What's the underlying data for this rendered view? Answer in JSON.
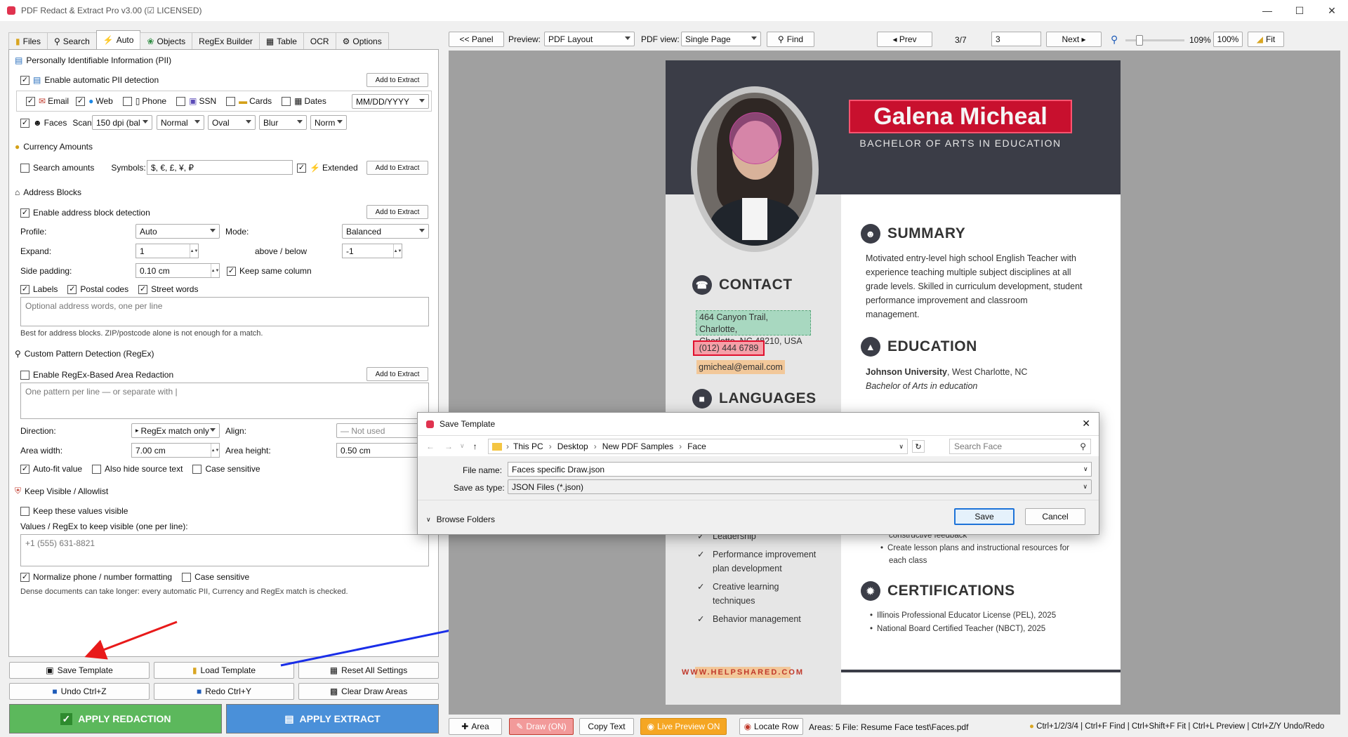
{
  "window": {
    "title": "PDF Redact & Extract Pro v3.00 (☑ LICENSED)"
  },
  "tabs": [
    {
      "label": "Files",
      "icon": "folder-icon"
    },
    {
      "label": "Search",
      "icon": "search-icon"
    },
    {
      "label": "Auto",
      "icon": "bolt-icon"
    },
    {
      "label": "Objects",
      "icon": "objects-icon"
    },
    {
      "label": "RegEx Builder",
      "icon": ""
    },
    {
      "label": "Table",
      "icon": "table-icon"
    },
    {
      "label": "OCR",
      "icon": ""
    },
    {
      "label": "Options",
      "icon": "gear-icon"
    }
  ],
  "pii": {
    "title": "Personally Identifiable Information (PII)",
    "enable": "Enable automatic PII detection",
    "add": "Add to Extract",
    "email": "Email",
    "web": "Web",
    "phone": "Phone",
    "ssn": "SSN",
    "cards": "Cards",
    "dates": "Dates",
    "date_format": "MM/DD/YYYY",
    "faces": "Faces",
    "scan": "Scan:",
    "scan_val": "150 dpi (bal",
    "mode_val": "Normal",
    "shape_val": "Oval",
    "effect_val": "Blur",
    "norm_val": "Norm"
  },
  "currency": {
    "title": "Currency Amounts",
    "search": "Search amounts",
    "symbols": "Symbols:",
    "symbols_val": "$, €, £, ¥, ₽",
    "extended": "Extended",
    "add": "Add to Extract"
  },
  "address": {
    "title": "Address Blocks",
    "enable": "Enable address block detection",
    "add": "Add to Extract",
    "profile": "Profile:",
    "profile_val": "Auto",
    "mode": "Mode:",
    "mode_val": "Balanced",
    "expand": "Expand:",
    "expand_val": "1",
    "above_below": "above / below",
    "ab_val": "-1",
    "side_padding": "Side padding:",
    "sp_val": "0.10 cm",
    "keep_col": "Keep same column",
    "labels": "Labels",
    "postal": "Postal codes",
    "street": "Street words",
    "placeholder": "Optional address words, one per line",
    "hint": "Best for address blocks. ZIP/postcode alone is not enough for a match."
  },
  "regex": {
    "title": "Custom Pattern Detection (RegEx)",
    "enable": "Enable RegEx-Based Area Redaction",
    "add": "Add to Extract",
    "placeholder": "One pattern per line  —  or separate with |",
    "direction": "Direction:",
    "direction_val": "RegEx match only",
    "align": "Align:",
    "align_val": "— Not used",
    "area_width": "Area width:",
    "aw_val": "7.00 cm",
    "area_height": "Area height:",
    "ah_val": "0.50 cm",
    "autofit": "Auto-fit value",
    "hide_source": "Also hide source text",
    "case": "Case sensitive"
  },
  "allow": {
    "title": "Keep Visible / Allowlist",
    "keep": "Keep these values visible",
    "values_label": "Values / RegEx to keep visible (one per line):",
    "placeholder": "+1 (555) 631-8821",
    "normalize": "Normalize phone / number formatting",
    "case": "Case sensitive",
    "hint": "Dense documents can take longer: every automatic PII, Currency and RegEx match is checked."
  },
  "bottom": {
    "save_template": "Save Template",
    "load_template": "Load Template",
    "reset": "Reset All Settings",
    "undo": "Undo  Ctrl+Z",
    "redo": "Redo  Ctrl+Y",
    "clear": "Clear Draw Areas",
    "apply_redaction": "APPLY REDACTION",
    "apply_extract": "APPLY EXTRACT"
  },
  "toolbar": {
    "panel": "<< Panel",
    "preview": "Preview:",
    "preview_val": "PDF Layout",
    "pdfview": "PDF view:",
    "pdfview_val": "Single Page",
    "find": "Find",
    "prev": "◂ Prev",
    "page_info": "3/7",
    "page_input": "3",
    "next": "Next ▸",
    "zoom_pct": "109%",
    "zoom_100": "100%",
    "fit": "Fit",
    "zoom_level": 0.2
  },
  "resume": {
    "name": "Galena Micheal",
    "degree": "BACHELOR OF ARTS IN EDUCATION",
    "contact": "CONTACT",
    "address_line1": "464 Canyon Trail, Charlotte,",
    "address_line2": "Charlotte, NC 48210, USA",
    "phone": "(012) 444 6789",
    "email": "gmicheal@email.com",
    "languages": "LANGUAGES",
    "summary": "SUMMARY",
    "summary_text": [
      "Motivated entry-level high school English Teacher with",
      "experience teaching multiple subject disciplines at all",
      "grade levels. Skilled in curriculum development, student",
      "performance improvement and classroom",
      "management."
    ],
    "education": "EDUCATION",
    "edu_school": "Johnson University",
    "edu_loc": ", West Charlotte, NC",
    "edu_degree": "Bachelor of Arts in education",
    "skills": [
      "Leadership",
      "Performance improvement",
      "plan development",
      "Creative learning",
      "techniques",
      "Behavior management"
    ],
    "exp_lines": [
      "constructive feedback",
      "Create lesson plans and instructional resources for",
      "each class"
    ],
    "certifications": "CERTIFICATIONS",
    "certs": [
      "Illinois Professional Educator License (PEL), 2025",
      "National Board Certified Teacher (NBCT), 2025"
    ],
    "website": "WWW.HELPSHARED.COM"
  },
  "dialog": {
    "title": "Save Template",
    "breadcrumb": [
      "This PC",
      "Desktop",
      "New PDF Samples",
      "Face"
    ],
    "search_placeholder": "Search Face",
    "file_name_label": "File name:",
    "file_name": "Faces specific Draw.json",
    "type_label": "Save as type:",
    "type_val": "JSON Files (*.json)",
    "browse": "Browse Folders",
    "save": "Save",
    "cancel": "Cancel"
  },
  "status": {
    "area": "Area",
    "draw": "Draw (ON)",
    "copy": "Copy Text",
    "live": "Live Preview ON",
    "locate": "Locate Row",
    "areas": "Areas: 5",
    "file": "File: Resume Face test\\Faces.pdf",
    "shortcuts": "Ctrl+1/2/3/4 | Ctrl+F Find | Ctrl+Shift+F Fit | Ctrl+L Preview | Ctrl+Z/Y Undo/Redo"
  },
  "colors": {
    "redact_green": "#5cb85c",
    "extract_blue": "#4a90d9",
    "header_dark": "#3b3d47",
    "name_box": "#c8102e"
  }
}
